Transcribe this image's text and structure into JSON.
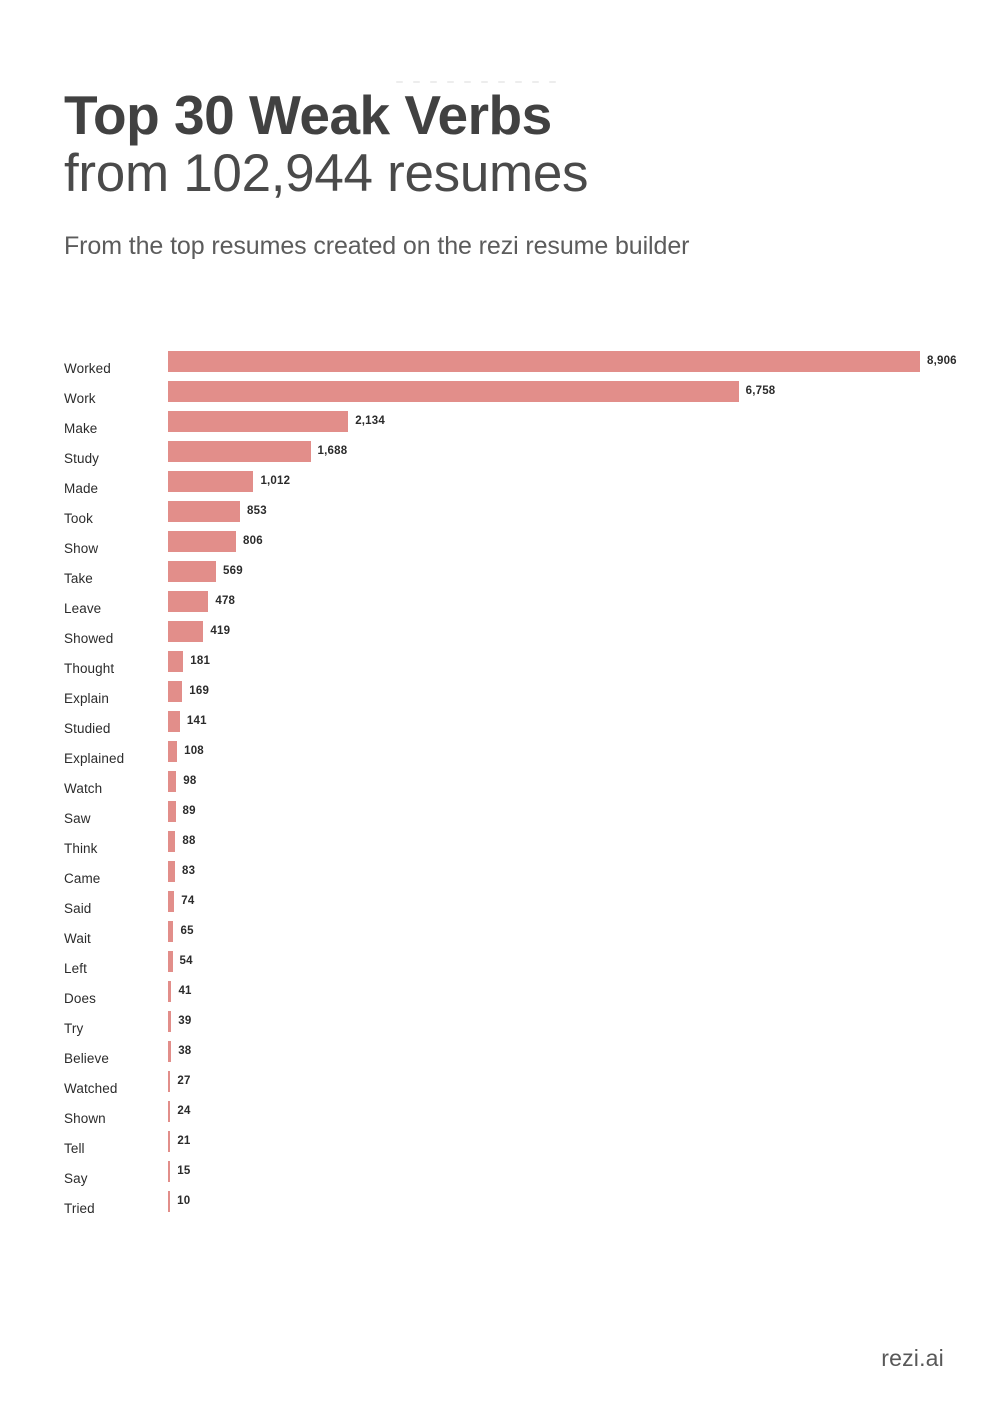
{
  "header": {
    "title_line1": "Top 30 Weak Verbs",
    "title_line2": "from 102,944 resumes",
    "subtitle": "From the top resumes created on the rezi resume builder"
  },
  "footer": {
    "brand": "rezi.ai"
  },
  "colors": {
    "bar": "#e28e8a",
    "title_text": "#414141",
    "subtitle_text": "#5c5c5c",
    "label_text": "#2b2b2b",
    "background": "#ffffff",
    "accent_dots": "#ededed"
  },
  "chart_data": {
    "type": "bar",
    "orientation": "horizontal",
    "title": "Top 30 Weak Verbs from 102,944 resumes",
    "subtitle": "From the top resumes created on the rezi resume builder",
    "xlabel": "",
    "ylabel": "",
    "xlim": [
      0,
      8906
    ],
    "grid": false,
    "legend": null,
    "value_labels": true,
    "categories": [
      "Worked",
      "Work",
      "Make",
      "Study",
      "Made",
      "Took",
      "Show",
      "Take",
      "Leave",
      "Showed",
      "Thought",
      "Explain",
      "Studied",
      "Explained",
      "Watch",
      "Saw",
      "Think",
      "Came",
      "Said",
      "Wait",
      "Left",
      "Does",
      "Try",
      "Believe",
      "Watched",
      "Shown",
      "Tell",
      "Say",
      "Tried"
    ],
    "values": [
      8906,
      6758,
      2134,
      1688,
      1012,
      853,
      806,
      569,
      478,
      419,
      181,
      169,
      141,
      108,
      98,
      89,
      88,
      83,
      74,
      65,
      54,
      41,
      39,
      38,
      27,
      24,
      21,
      15,
      10
    ],
    "value_labels_text": [
      "8,906",
      "6,758",
      "2,134",
      "1,688",
      "1,012",
      "853",
      "806",
      "569",
      "478",
      "419",
      "181",
      "169",
      "141",
      "108",
      "98",
      "89",
      "88",
      "83",
      "74",
      "65",
      "54",
      "41",
      "39",
      "38",
      "27",
      "24",
      "21",
      "15",
      "10"
    ]
  }
}
